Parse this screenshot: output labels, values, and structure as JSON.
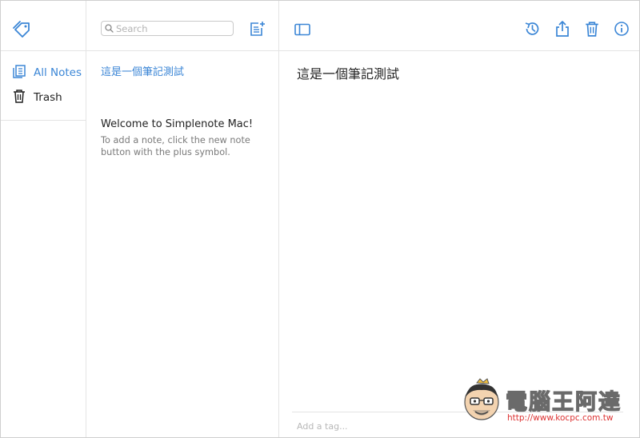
{
  "window": {
    "title": "Simplenote"
  },
  "sidebar": {
    "items": [
      {
        "label": "All Notes",
        "icon": "notes-icon",
        "active": true
      },
      {
        "label": "Trash",
        "icon": "trash-icon",
        "active": false
      }
    ]
  },
  "note_list": {
    "search_placeholder": "Search",
    "notes": [
      {
        "title": "這是一個筆記測試",
        "preview": "",
        "selected": true
      },
      {
        "title": "Welcome to Simplenote Mac!",
        "preview": "To add a note, click the new note button with the plus symbol.",
        "selected": false
      }
    ]
  },
  "editor": {
    "content": "這是一個筆記測試",
    "tag_placeholder": "Add a tag..."
  },
  "watermark": {
    "title": "電腦王阿達",
    "url": "http://www.kocpc.com.tw"
  },
  "colors": {
    "accent": "#3b86d6",
    "divider": "#e4e4e4",
    "text": "#222222",
    "muted": "#7a7a7a"
  }
}
